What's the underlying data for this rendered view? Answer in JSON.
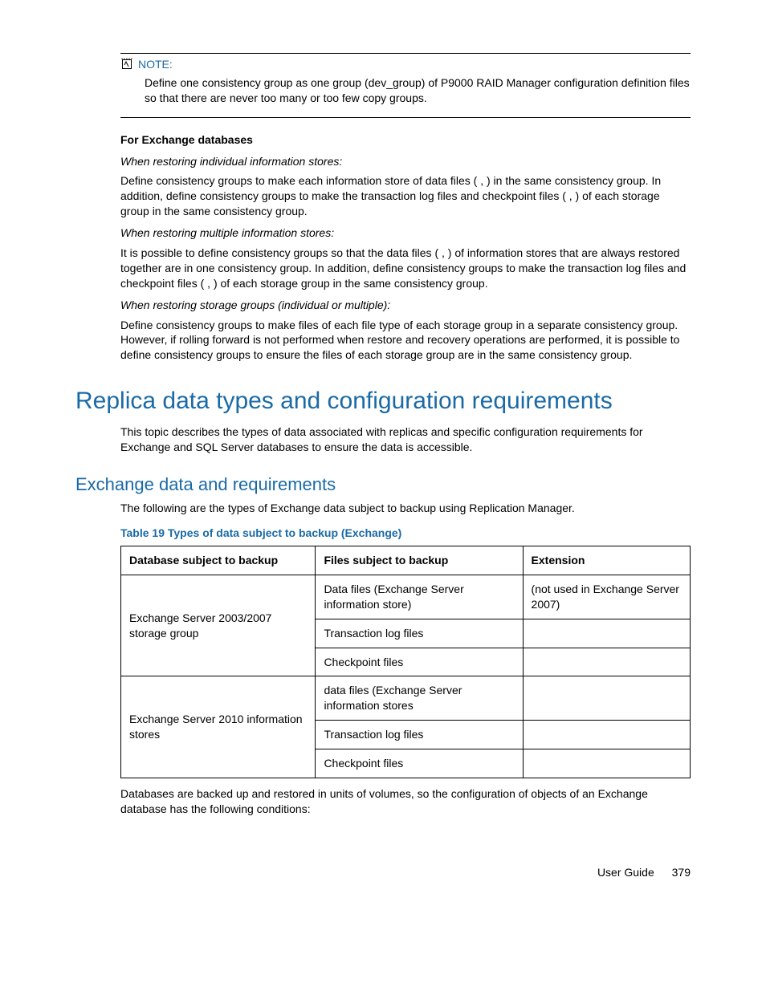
{
  "note": {
    "label": "NOTE:",
    "body": "Define one consistency group as one group (dev_group) of P9000 RAID Manager configuration definition files so that there are never too many or too few copy groups."
  },
  "exchange": {
    "heading": "For Exchange databases",
    "s1_title": "When restoring individual information stores:",
    "s1_body": "Define consistency groups to make each information store of data files (            ,           ) in the same consistency group. In addition, define consistency groups to make the transaction log files and checkpoint files (            ,           ) of each storage group in the same consistency group.",
    "s2_title": "When restoring multiple information stores:",
    "s2_body": "It is possible to define consistency groups so that the data files (            ,           ) of information stores that are always restored together are in one consistency group. In addition, define consistency groups to make the transaction log files and checkpoint files (            ,           ) of each storage group in the same consistency group.",
    "s3_title": "When restoring storage groups (individual or multiple):",
    "s3_body": "Define consistency groups to make files of each file type of each storage group in a separate consistency group. However, if rolling forward is not performed when restore and recovery operations are performed, it is possible to define consistency groups to ensure the files of each storage group are in the same consistency group."
  },
  "h1": "Replica data types and configuration requirements",
  "h1_body": "This topic describes the types of data associated with replicas and specific configuration requirements for Exchange and SQL Server databases to ensure the data is accessible.",
  "h2": "Exchange data and requirements",
  "h2_body": "The following are the types of Exchange data subject to backup using Replication Manager.",
  "table_caption": "Table 19 Types of data subject to backup (Exchange)",
  "table": {
    "headers": [
      "Database subject to backup",
      "Files subject to backup",
      "Extension"
    ],
    "rows": [
      {
        "db": "Exchange Server 2003/2007 storage group",
        "files": [
          "Data files (Exchange Server information store)",
          "Transaction log files",
          "Checkpoint files"
        ],
        "ext": [
          "        (not used in Exchange Server 2007)",
          "",
          ""
        ]
      },
      {
        "db": "Exchange Server 2010 information stores",
        "files": [
          "data files (Exchange Server information stores",
          "Transaction log files",
          "Checkpoint files"
        ],
        "ext": [
          "",
          "",
          ""
        ]
      }
    ]
  },
  "after_table": "Databases are backed up and restored in units of volumes, so the configuration of objects of an Exchange database has the following conditions:",
  "footer": {
    "label": "User Guide",
    "page": "379"
  }
}
